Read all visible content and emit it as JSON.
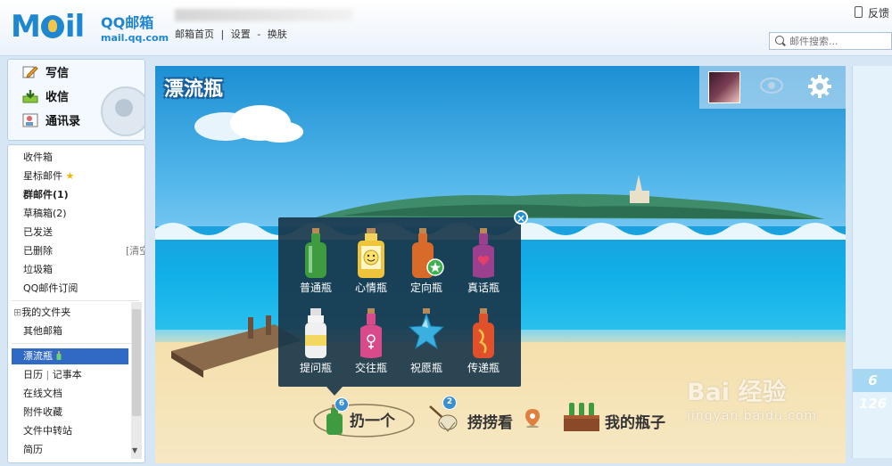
{
  "header": {
    "logo_text_prefix": "M",
    "logo_text_suffix": "il",
    "brand_name": "QQ邮箱",
    "brand_domain": "mail.qq.com",
    "links": [
      "邮箱首页",
      "|",
      "设置",
      "-",
      "换肤"
    ],
    "feedback": "反馈",
    "search_placeholder": "邮件搜索..."
  },
  "sidebar": {
    "actions": [
      {
        "label": "写信",
        "icon": "pencil-icon"
      },
      {
        "label": "收信",
        "icon": "inbox-download-icon"
      },
      {
        "label": "通讯录",
        "icon": "contacts-icon"
      }
    ],
    "folders": [
      {
        "label": "收件箱"
      },
      {
        "label": "星标邮件"
      },
      {
        "label": "群邮件(1)"
      },
      {
        "label": "草稿箱(2)"
      },
      {
        "label": "已发送"
      },
      {
        "label": "已删除",
        "extra": "[清空]"
      },
      {
        "label": "垃圾箱"
      },
      {
        "label": "QQ邮件订阅"
      },
      {
        "label": "我的文件夹"
      },
      {
        "label": "其他邮箱"
      },
      {
        "label": "漂流瓶"
      },
      {
        "label": "日历",
        "extra": "记事本"
      },
      {
        "label": "在线文档"
      },
      {
        "label": "附件收藏"
      },
      {
        "label": "文件中转站"
      },
      {
        "label": "简历"
      }
    ],
    "expand_glyph": "⊞",
    "star_glyph": "★",
    "separator": "|",
    "scroll_down": "▼"
  },
  "main": {
    "title": "漂流瓶",
    "gear_icon": "gear-icon",
    "eye_icon": "eye-icon",
    "popup": {
      "close_glyph": "×",
      "bottles": [
        {
          "label": "普通瓶",
          "color": "#3f9b3f"
        },
        {
          "label": "心情瓶",
          "color": "#f0c43a"
        },
        {
          "label": "定向瓶",
          "color": "#d86a2a"
        },
        {
          "label": "真话瓶",
          "color": "#9b3f8f"
        },
        {
          "label": "提问瓶",
          "color": "#e8e8e8"
        },
        {
          "label": "交往瓶",
          "color": "#d84a8a"
        },
        {
          "label": "祝愿瓶",
          "color": "#3ab0e0"
        },
        {
          "label": "传递瓶",
          "color": "#e0502a"
        }
      ]
    },
    "actions": {
      "throw": {
        "label": "扔一个",
        "count": "6"
      },
      "fish": {
        "label": "捞捞看",
        "count": "2"
      },
      "mine": {
        "label": "我的瓶子"
      }
    }
  },
  "right_panel": {
    "number": "6 126"
  },
  "watermark": {
    "brand": "Bai  经验",
    "url": "jingyan.baidu.com"
  }
}
